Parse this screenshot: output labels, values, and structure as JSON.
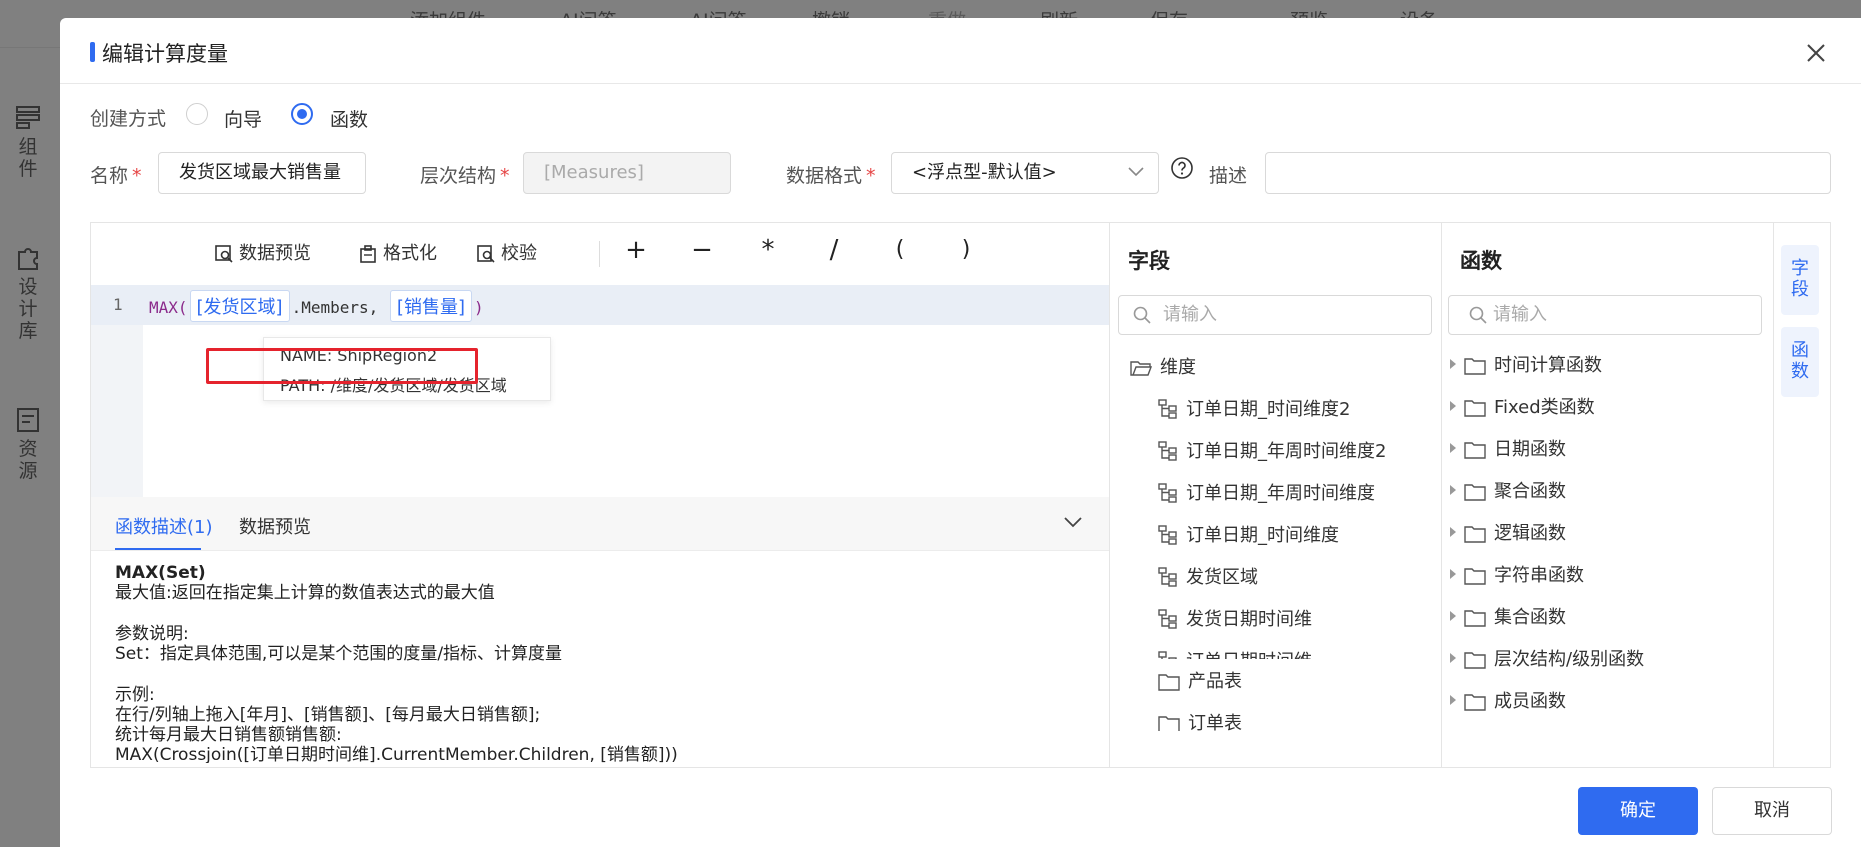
{
  "background": {
    "toolbar": [
      "添加组件",
      "AI问答",
      "AI问答",
      "撤销",
      "重做",
      "刷新",
      "保存",
      "预览",
      "设备"
    ],
    "left_nav": [
      {
        "label": "组件",
        "icon": "component-icon"
      },
      {
        "label": "设计库",
        "icon": "puzzle-icon"
      },
      {
        "label": "资源",
        "icon": "resource-icon"
      }
    ]
  },
  "dialog": {
    "title": "编辑计算度量",
    "create_mode": {
      "label": "创建方式",
      "options": [
        "向导",
        "函数"
      ],
      "selected": "函数"
    },
    "name": {
      "label": "名称",
      "value": "发货区域最大销售量"
    },
    "hierarchy": {
      "label": "层次结构",
      "value": "[Measures]"
    },
    "format": {
      "label": "数据格式",
      "value": "<浮点型-默认值>"
    },
    "description": {
      "label": "描述",
      "value": ""
    },
    "toolbar": {
      "preview": "数据预览",
      "format": "格式化",
      "validate": "校验",
      "operators": [
        "+",
        "−",
        "*",
        "/",
        "(",
        ")"
      ]
    },
    "editor": {
      "line_number": "1",
      "func": "MAX(",
      "token1": "[发货区域]",
      "mid": ".Members,",
      "token2": "[销售量]",
      "close": ")"
    },
    "tooltip": {
      "name": "NAME: ShipRegion2",
      "path": "PATH: /维度/发货区域/发货区域"
    },
    "desc_tabs": {
      "tab1": "函数描述(1)",
      "tab2": "数据预览"
    },
    "desc": {
      "fn": "MAX(Set)",
      "summary": "最大值:返回在指定集上计算的数值表达式的最大值",
      "params_title": "参数说明:",
      "params": "Set：指定具体范围,可以是某个范围的度量/指标、计算度量",
      "example_title": "示例:",
      "example1": "在行/列轴上拖入[年月]、[销售额]、[每月最大日销售额];",
      "example2": "统计每月最大日销售额销售额:",
      "example3": "MAX(Crossjoin([订单日期时间维].CurrentMember.Children, [销售额]))"
    },
    "fields": {
      "title": "字段",
      "search_placeholder": "请输入",
      "root": "维度",
      "items": [
        "订单日期_时间维度2",
        "订单日期_年周时间维度2",
        "订单日期_年周时间维度",
        "订单日期_时间维度",
        "发货区域",
        "发货日期时间维",
        "订单日期时间维"
      ],
      "folder": "产品表",
      "next": "订单表"
    },
    "functions": {
      "title": "函数",
      "search_placeholder": "请输入",
      "items": [
        "时间计算函数",
        "Fixed类函数",
        "日期函数",
        "聚合函数",
        "逻辑函数",
        "字符串函数",
        "集合函数",
        "层次结构/级别函数",
        "成员函数"
      ]
    },
    "side_tabs": {
      "tab1_line1": "字",
      "tab1_line2": "段",
      "tab2_line1": "函",
      "tab2_line2": "数"
    },
    "buttons": {
      "ok": "确定",
      "cancel": "取消"
    },
    "colors": {
      "accent": "#2f6bf0",
      "highlight": "#e5232d"
    }
  }
}
